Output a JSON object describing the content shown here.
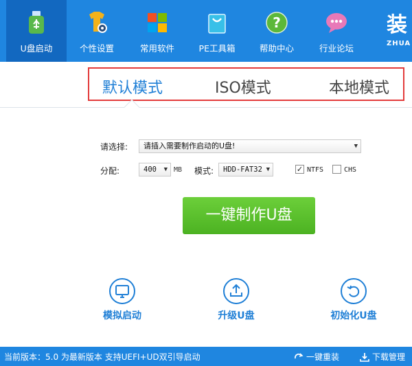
{
  "nav": {
    "items": [
      {
        "label": "U盘启动",
        "icon": "usb-drive-icon"
      },
      {
        "label": "个性设置",
        "icon": "tshirt-gear-icon"
      },
      {
        "label": "常用软件",
        "icon": "windows-tiles-icon"
      },
      {
        "label": "PE工具箱",
        "icon": "shopping-bag-icon"
      },
      {
        "label": "帮助中心",
        "icon": "help-question-icon"
      },
      {
        "label": "行业论坛",
        "icon": "chat-bubble-icon"
      }
    ],
    "brand_big": "装",
    "brand_small": "ZHUA"
  },
  "mode_tabs": [
    "默认模式",
    "ISO模式",
    "本地模式"
  ],
  "form": {
    "select_label": "请选择:",
    "select_value": "请插入需要制作启动的U盘!",
    "partition_label": "分配:",
    "partition_value": "400",
    "partition_unit": "MB",
    "mode_label": "模式:",
    "mode_value": "HDD-FAT32",
    "ntfs_label": "NTFS",
    "ntfs_checked": true,
    "chs_label": "CHS",
    "chs_checked": false
  },
  "main_button": "一键制作U盘",
  "actions": [
    {
      "label": "模拟启动",
      "icon": "monitor-icon"
    },
    {
      "label": "升级U盘",
      "icon": "upload-tray-icon"
    },
    {
      "label": "初始化U盘",
      "icon": "undo-arrow-icon"
    }
  ],
  "status": {
    "version_text": "当前版本：5.0 为最新版本 支持UEFI+UD双引导启动",
    "reinstall_label": "一键重装",
    "download_label": "下载管理"
  },
  "colors": {
    "brand_blue": "#1f86e0",
    "active_nav": "#1268c0",
    "accent_blue": "#1f7fd6",
    "button_green": "#5ec02c",
    "highlight_red": "#e33a3a"
  }
}
